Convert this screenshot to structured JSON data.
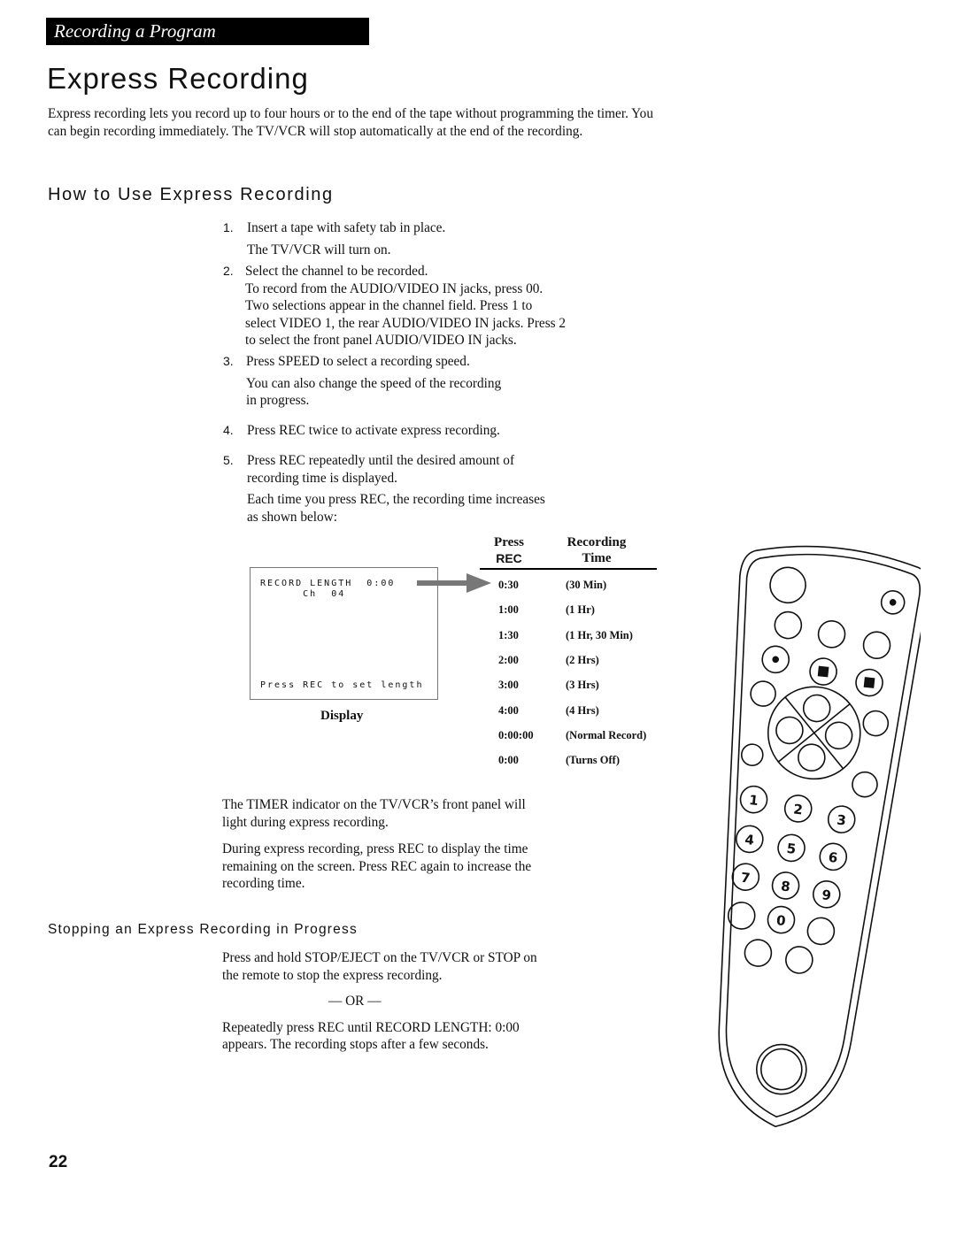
{
  "header": {
    "section": "Recording a Program",
    "title": "Express Recording"
  },
  "intro": "Express recording lets you record up to four hours or to the end of the tape without programming the timer. You can begin recording immediately. The TV/VCR will stop automatically at the end of the recording.",
  "how_to": {
    "heading": "How to Use Express Recording",
    "steps": [
      {
        "num": "1.",
        "lines": [
          "Insert a tape with safety tab in place.",
          "The TV/VCR will turn on."
        ]
      },
      {
        "num": "2.",
        "lines": [
          "Select the channel to be recorded.",
          "To record from the AUDIO/VIDEO IN jacks, press  00.",
          "Two selections appear in the channel field. Press 1 to",
          "select VIDEO 1, the rear AUDIO/VIDEO IN jacks. Press 2",
          "to select the front panel AUDIO/VIDEO IN jacks."
        ]
      },
      {
        "num": "3.",
        "lines": [
          "Press SPEED to select a recording speed.",
          "You can also change the speed of the recording",
          "in progress."
        ]
      },
      {
        "num": "4.",
        "lines": [
          "Press REC twice to activate express recording."
        ]
      },
      {
        "num": "5.",
        "lines": [
          "Press REC repeatedly until the desired amount of",
          "recording time is displayed.",
          "Each time you press REC, the recording time increases",
          "as shown below:"
        ]
      }
    ]
  },
  "display": {
    "line1": "RECORD LENGTH  0:00",
    "line2": "      Ch  04",
    "line3": "Press REC to set length",
    "caption": "Display"
  },
  "table": {
    "col1": [
      "Press",
      "REC"
    ],
    "col2": [
      "Recording",
      "Time"
    ],
    "rows": [
      [
        "0:30",
        "(30 Min)"
      ],
      [
        "1:00",
        "(1 Hr)"
      ],
      [
        "1:30",
        "(1 Hr, 30 Min)"
      ],
      [
        "2:00",
        "(2 Hrs)"
      ],
      [
        "3:00",
        "(3 Hrs)"
      ],
      [
        "4:00",
        "(4 Hrs)"
      ],
      [
        "0:00:00",
        "(Normal Record)"
      ],
      [
        "0:00",
        "(Turns Off)"
      ]
    ]
  },
  "after": [
    "The TIMER indicator on the TV/VCR’s front panel will",
    "light during express recording.",
    "During express recording, press REC to display the time",
    "remaining on the screen.  Press REC again to increase the",
    "recording time."
  ],
  "stopping": {
    "heading": "Stopping an Express Recording in Progress",
    "lines": [
      "Press and hold STOP/EJECT on the TV/VCR or STOP on",
      "the remote to stop the express recording.",
      "— OR —",
      "Repeatedly press REC until RECORD LENGTH: 0:00",
      "appears.  The recording stops after a few seconds."
    ]
  },
  "page_number": "22",
  "remote": {
    "icon": "remote-control-illustration",
    "digits": [
      "1",
      "2",
      "3",
      "4",
      "5",
      "6",
      "7",
      "8",
      "9",
      "0"
    ]
  }
}
